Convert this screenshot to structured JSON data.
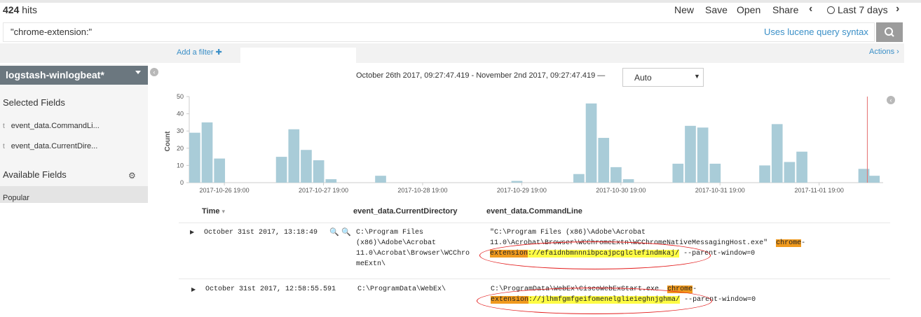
{
  "header": {
    "hits_count": "424",
    "hits_label": "hits",
    "nav": [
      "New",
      "Save",
      "Open",
      "Share"
    ],
    "time_label": "Last 7 days"
  },
  "search": {
    "query": "\"chrome-extension:\"",
    "syntax_link": "Uses lucene query syntax"
  },
  "filter_bar": {
    "add_filter": "Add a filter",
    "actions": "Actions"
  },
  "sidebar": {
    "index_pattern": "logstash-winlogbeat*",
    "selected_fields_title": "Selected Fields",
    "selected_fields": [
      {
        "type": "t",
        "name": "event_data.CommandLi..."
      },
      {
        "type": "t",
        "name": "event_data.CurrentDire..."
      }
    ],
    "available_fields_title": "Available Fields",
    "popular": "Popular"
  },
  "histogram": {
    "time_range": "October 26th 2017, 09:27:47.419 - November 2nd 2017, 09:27:47.419 —",
    "interval": "Auto"
  },
  "chart_data": {
    "type": "bar",
    "ylabel": "Count",
    "ylim": [
      0,
      50
    ],
    "yticks": [
      0,
      10,
      20,
      30,
      40,
      50
    ],
    "xticks": [
      "2017-10-26 19:00",
      "2017-10-27 19:00",
      "2017-10-28 19:00",
      "2017-10-29 19:00",
      "2017-10-30 19:00",
      "2017-10-31 19:00",
      "2017-11-01 19:00"
    ],
    "x_hours_range": [
      0,
      168
    ],
    "bars": [
      {
        "h": 0,
        "v": 29
      },
      {
        "h": 3,
        "v": 35
      },
      {
        "h": 6,
        "v": 14
      },
      {
        "h": 21,
        "v": 15
      },
      {
        "h": 24,
        "v": 31
      },
      {
        "h": 27,
        "v": 19
      },
      {
        "h": 30,
        "v": 13
      },
      {
        "h": 33,
        "v": 2
      },
      {
        "h": 45,
        "v": 4
      },
      {
        "h": 78,
        "v": 1
      },
      {
        "h": 93,
        "v": 5
      },
      {
        "h": 96,
        "v": 46
      },
      {
        "h": 99,
        "v": 26
      },
      {
        "h": 102,
        "v": 9
      },
      {
        "h": 105,
        "v": 2
      },
      {
        "h": 117,
        "v": 11
      },
      {
        "h": 120,
        "v": 33
      },
      {
        "h": 123,
        "v": 32
      },
      {
        "h": 126,
        "v": 11
      },
      {
        "h": 138,
        "v": 10
      },
      {
        "h": 141,
        "v": 34
      },
      {
        "h": 144,
        "v": 12
      },
      {
        "h": 147,
        "v": 18
      },
      {
        "h": 162,
        "v": 8
      },
      {
        "h": 164.5,
        "v": 4
      }
    ],
    "now_marker_h": 164
  },
  "table": {
    "columns": [
      "Time",
      "event_data.CurrentDirectory",
      "event_data.CommandLine"
    ],
    "rows": [
      {
        "time": "October 31st 2017, 13:18:49",
        "dir": [
          "C:\\Program Files",
          "(x86)\\Adobe\\Acrobat",
          "11.0\\Acrobat\\Browser\\WCChro",
          "meExtn\\"
        ],
        "cmd_line1": "\"C:\\Program Files (x86)\\Adobe\\Acrobat",
        "cmd_line2": "11.0\\Acrobat\\Browser\\WCChromeExtn\\WCChromeNativeMessagingHost.exe\"",
        "cmd_hl1": "chrome",
        "cmd_dash": "-",
        "cmd_hl2": "extension",
        "cmd_url": "://efaidnbmnnnibpcajpcglclefindmkaj/",
        "cmd_tail": "--parent-window=0"
      },
      {
        "time": "October 31st 2017, 12:58:55.591",
        "dir": [
          "C:\\ProgramData\\WebEx\\"
        ],
        "cmd_line1": "C:\\ProgramData\\WebEx\\CiscoWebExStart.exe",
        "cmd_hl1": "chrome",
        "cmd_dash": "-",
        "cmd_hl2": "extension",
        "cmd_url": "://jlhmfgmfgeifomenelglieieghnjghma/",
        "cmd_tail": "--parent-window=0"
      }
    ]
  }
}
